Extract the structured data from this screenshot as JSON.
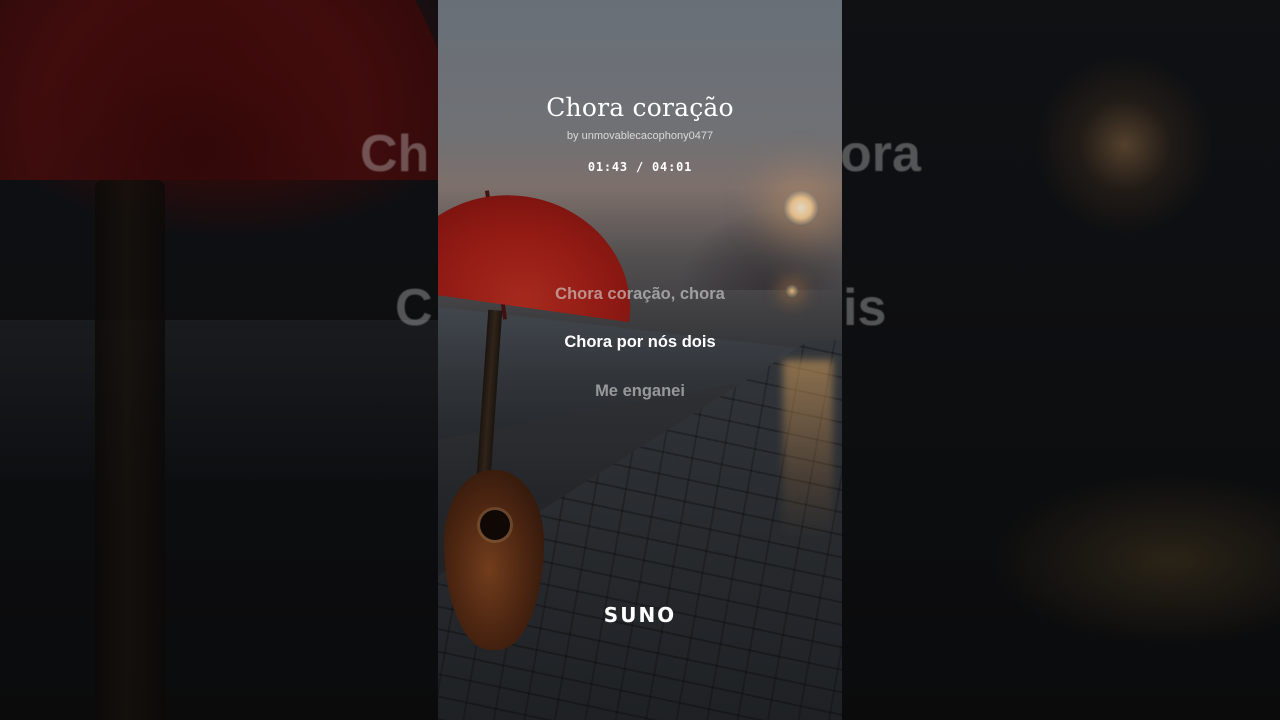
{
  "song": {
    "title": "Chora coração",
    "artist": "by unmovablecacophony0477",
    "elapsed": "01:43",
    "separator": "/",
    "duration": "04:01",
    "time_display": "01:43 / 04:01"
  },
  "lyrics": {
    "previous": "Chora coração, chora",
    "current": "Chora por nós dois",
    "next": "Me enganei"
  },
  "backdrop_lyrics": {
    "left_1": "Ch",
    "right_1": "ora",
    "left_2": "C",
    "right_2": "is"
  },
  "brand": {
    "logo_text": "SUNO"
  },
  "colors": {
    "umbrella": "#a41d16",
    "text_primary": "#ffffff",
    "text_dim": "#d7d7d7"
  }
}
